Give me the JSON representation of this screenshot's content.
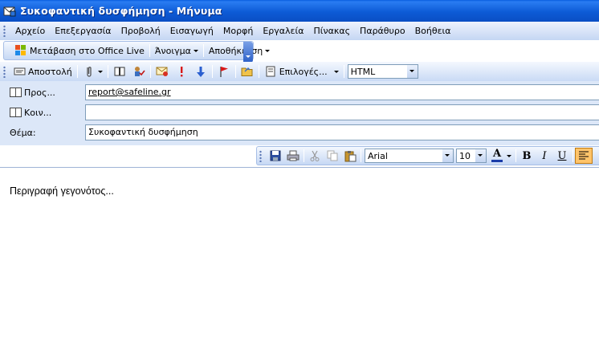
{
  "window": {
    "title": "Συκοφαντική δυσφήμηση - Μήνυμα"
  },
  "menubar": {
    "items": [
      {
        "label": "Αρχείο"
      },
      {
        "label": "Επεξεργασία"
      },
      {
        "label": "Προβολή"
      },
      {
        "label": "Εισαγωγή"
      },
      {
        "label": "Μορφή"
      },
      {
        "label": "Εργαλεία"
      },
      {
        "label": "Πίνακας"
      },
      {
        "label": "Παράθυρο"
      },
      {
        "label": "Βοήθεια"
      }
    ]
  },
  "toolbar_web": {
    "office_live": "Μετάβαση στο Office Live",
    "open": "Άνοιγμα",
    "save": "Αποθήκευση"
  },
  "toolbar_mail": {
    "send": "Αποστολή",
    "options": "Επιλογές...",
    "format_value": "HTML"
  },
  "header": {
    "to_label": "Προς...",
    "to_value": "report@safeline.gr",
    "cc_label": "Κοιν...",
    "cc_value": "",
    "subject_label": "Θέμα:",
    "subject_value": "Συκοφαντική δυσφήμηση"
  },
  "formatting": {
    "font": "Arial",
    "size": "10",
    "bold": "B",
    "italic": "I",
    "underline": "U",
    "font_color_glyph": "A"
  },
  "body": {
    "text": "Περιγραφή γεγονότος..."
  }
}
